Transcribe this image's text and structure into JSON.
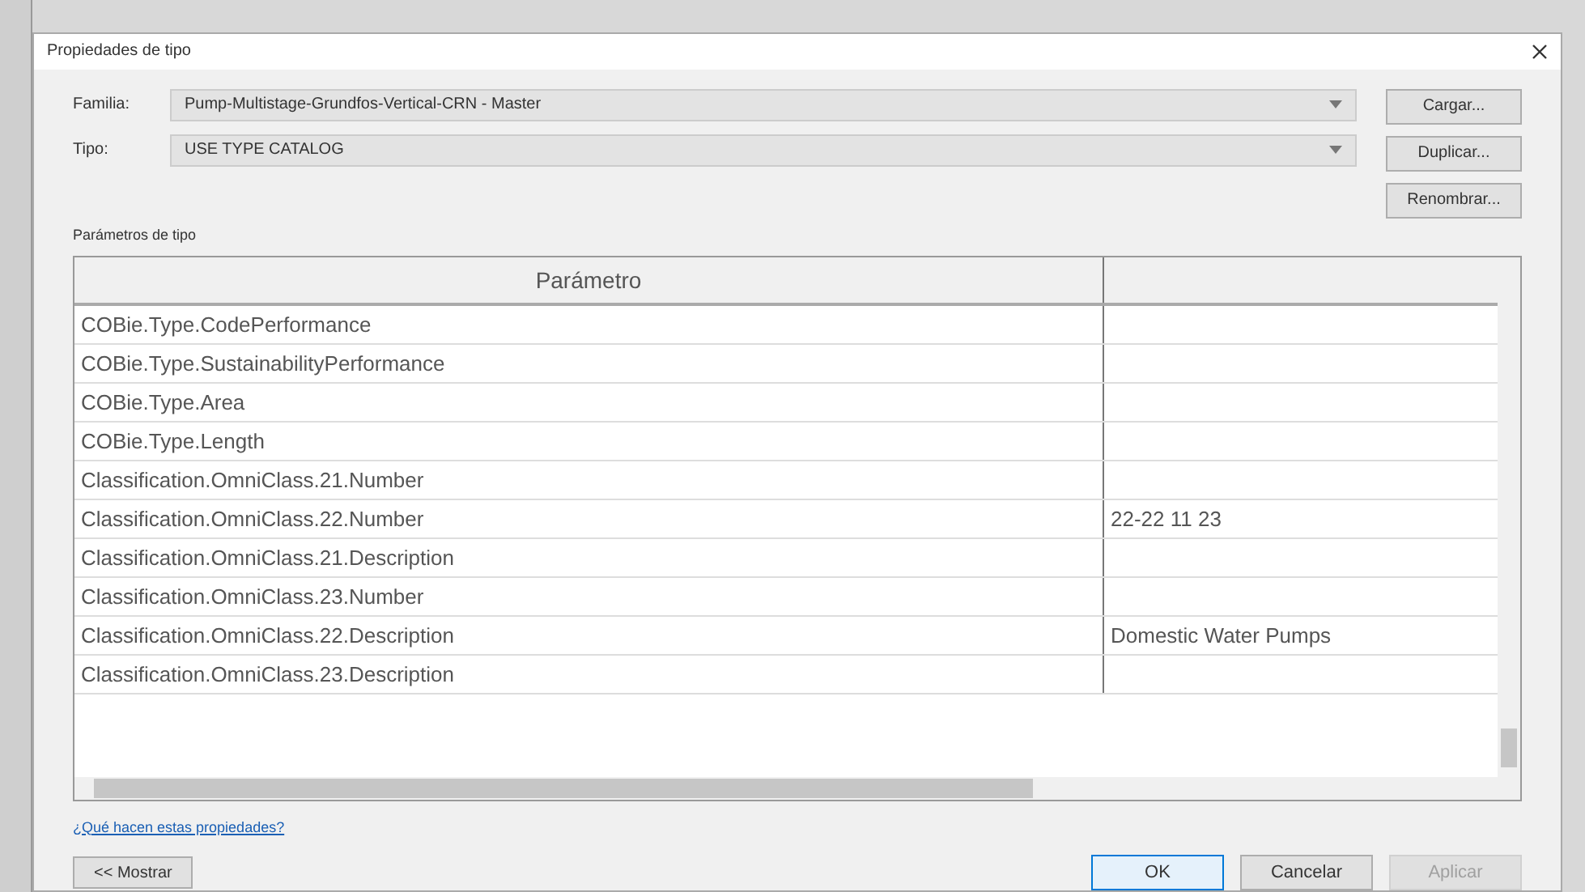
{
  "window": {
    "title": "Propiedades de tipo"
  },
  "fields": [
    {
      "label": "Familia:",
      "value": "Pump-Multistage-Grundfos-Vertical-CRN - Master"
    },
    {
      "label": "Tipo:",
      "value": "USE TYPE CATALOG"
    }
  ],
  "side_buttons": [
    "Cargar...",
    "Duplicar...",
    "Renombrar..."
  ],
  "section_label": "Parámetros de tipo",
  "table": {
    "columns": [
      "Parámetro"
    ],
    "rows": [
      [
        "COBie.Type.CodePerformance",
        ""
      ],
      [
        "COBie.Type.SustainabilityPerformance",
        ""
      ],
      [
        "COBie.Type.Area",
        ""
      ],
      [
        "COBie.Type.Length",
        ""
      ],
      [
        "Classification.OmniClass.21.Number",
        ""
      ],
      [
        "Classification.OmniClass.22.Number",
        "22-22 11 23"
      ],
      [
        "Classification.OmniClass.21.Description",
        ""
      ],
      [
        "Classification.OmniClass.23.Number",
        ""
      ],
      [
        "Classification.OmniClass.22.Description",
        "Domestic Water Pumps"
      ],
      [
        "Classification.OmniClass.23.Description",
        ""
      ]
    ]
  },
  "help_link": "¿Qué hacen estas propiedades?",
  "preview_button": "<< Mostrar",
  "buttons": [
    {
      "label": "OK",
      "kind": "default",
      "disabled": false
    },
    {
      "label": "Cancelar",
      "kind": "normal",
      "disabled": false
    },
    {
      "label": "Aplicar",
      "kind": "normal",
      "disabled": true
    }
  ]
}
